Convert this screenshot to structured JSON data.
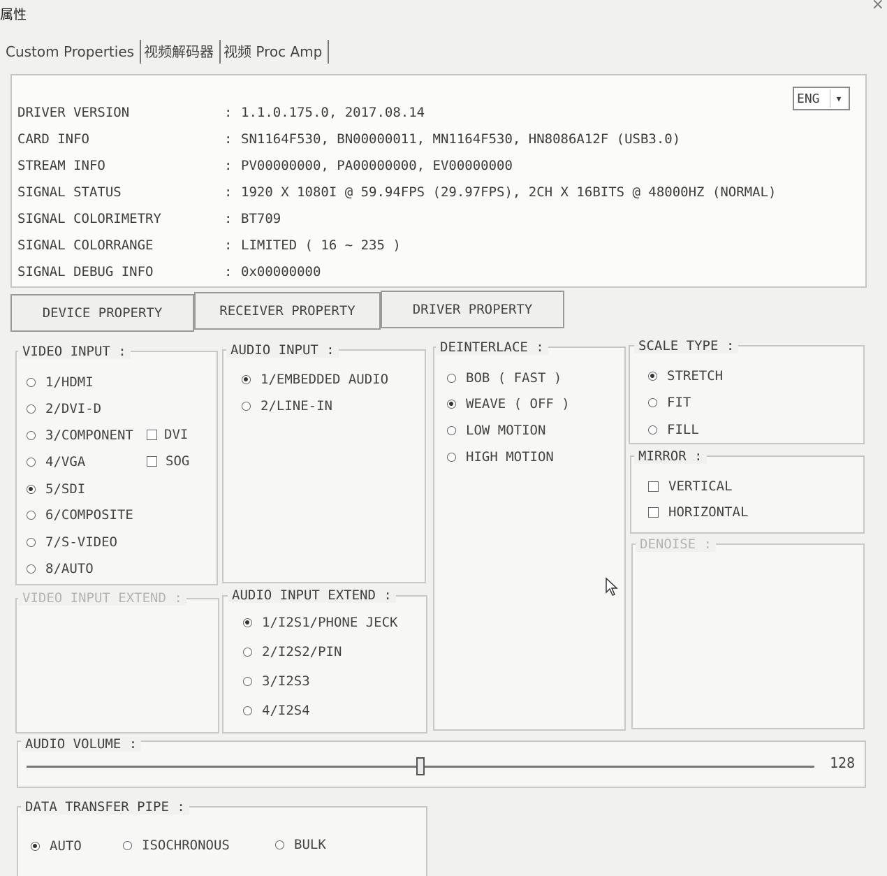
{
  "window": {
    "title": "属性"
  },
  "tabs": [
    "Custom Properties",
    "视频解码器",
    "视频 Proc Amp"
  ],
  "info": [
    {
      "label": "DRIVER VERSION",
      "value": "1.1.0.175.0, 2017.08.14"
    },
    {
      "label": "CARD INFO",
      "value": "SN1164F530, BN00000011, MN1164F530, HN8086A12F (USB3.0)"
    },
    {
      "label": "STREAM INFO",
      "value": "PV00000000, PA00000000, EV00000000"
    },
    {
      "label": "SIGNAL STATUS",
      "value": "1920 X 1080I @ 59.94FPS (29.97FPS), 2CH X 16BITS @ 48000HZ (NORMAL)"
    },
    {
      "label": "SIGNAL COLORIMETRY",
      "value": "BT709"
    },
    {
      "label": "SIGNAL COLORRANGE",
      "value": "LIMITED ( 16 ~ 235 )"
    },
    {
      "label": "SIGNAL DEBUG INFO",
      "value": "0x00000000"
    }
  ],
  "language": {
    "selected": "ENG"
  },
  "property_buttons": [
    "DEVICE PROPERTY",
    "RECEIVER PROPERTY",
    "DRIVER PROPERTY"
  ],
  "video_input": {
    "title": "VIDEO INPUT :",
    "options": [
      "1/HDMI",
      "2/DVI-D",
      "3/COMPONENT",
      "4/VGA",
      "5/SDI",
      "6/COMPOSITE",
      "7/S-VIDEO",
      "8/AUTO"
    ],
    "selected": 4,
    "checkboxes": [
      "DVI",
      "SOG"
    ]
  },
  "video_input_extend": {
    "title": "VIDEO INPUT EXTEND :"
  },
  "audio_input": {
    "title": "AUDIO INPUT :",
    "options": [
      "1/EMBEDDED AUDIO",
      "2/LINE-IN"
    ],
    "selected": 0
  },
  "audio_input_extend": {
    "title": "AUDIO INPUT EXTEND :",
    "options": [
      "1/I2S1/PHONE JECK",
      "2/I2S2/PIN",
      "3/I2S3",
      "4/I2S4"
    ],
    "selected": 0
  },
  "deinterlace": {
    "title": "DEINTERLACE :",
    "options": [
      "BOB ( FAST )",
      "WEAVE ( OFF )",
      "LOW MOTION",
      "HIGH MOTION"
    ],
    "selected": 1
  },
  "scale_type": {
    "title": "SCALE TYPE :",
    "options": [
      "STRETCH",
      "FIT",
      "FILL"
    ],
    "selected": 0
  },
  "mirror": {
    "title": "MIRROR :",
    "options": [
      "VERTICAL",
      "HORIZONTAL"
    ]
  },
  "denoise": {
    "title": "DENOISE :"
  },
  "audio_volume": {
    "title": "AUDIO VOLUME :",
    "value": "128",
    "level": 0.5
  },
  "data_transfer_pipe": {
    "title": "DATA TRANSFER PIPE :",
    "options": [
      "AUTO",
      "ISOCHRONOUS",
      "BULK"
    ],
    "selected": 0
  }
}
